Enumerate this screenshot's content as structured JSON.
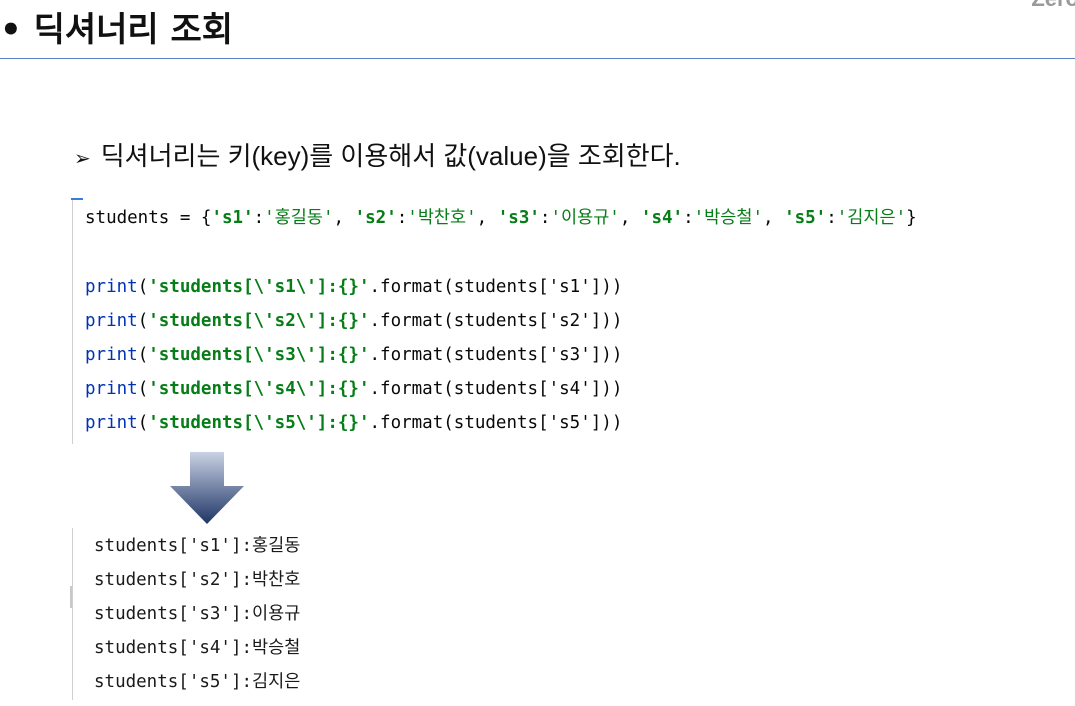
{
  "header": {
    "title": "• 딕셔너리 조회",
    "logo_text": "Zero"
  },
  "bullet": {
    "marker": "➢",
    "text": "딕셔너리는 키(key)를 이용해서 값(value)을 조회한다."
  },
  "code": {
    "dict_line": {
      "prefix": "students = {",
      "items": [
        {
          "key": "'s1'",
          "value": "'홍길동'"
        },
        {
          "key": "'s2'",
          "value": "'박찬호'"
        },
        {
          "key": "'s3'",
          "value": "'이용규'"
        },
        {
          "key": "'s4'",
          "value": "'박승철'"
        },
        {
          "key": "'s5'",
          "value": "'김지은'"
        }
      ],
      "suffix": "}"
    },
    "print_lines": [
      {
        "fn": "print",
        "fmt": "'students[\\'s1\\']:{}'",
        "rest": ".format(students['s1']))"
      },
      {
        "fn": "print",
        "fmt": "'students[\\'s2\\']:{}'",
        "rest": ".format(students['s2']))"
      },
      {
        "fn": "print",
        "fmt": "'students[\\'s3\\']:{}'",
        "rest": ".format(students['s3']))"
      },
      {
        "fn": "print",
        "fmt": "'students[\\'s4\\']:{}'",
        "rest": ".format(students['s4']))"
      },
      {
        "fn": "print",
        "fmt": "'students[\\'s5\\']:{}'",
        "rest": ".format(students['s5']))"
      }
    ]
  },
  "output": {
    "lines": [
      "students['s1']:홍길동",
      "students['s2']:박찬호",
      "students['s3']:이용규",
      "students['s4']:박승철",
      "students['s5']:김지은"
    ]
  },
  "colors": {
    "keyword": "#0033b3",
    "string": "#067d17",
    "rule": "#5b7fc4",
    "arrow_top": "#c9d2e4",
    "arrow_bottom": "#1f3566"
  }
}
